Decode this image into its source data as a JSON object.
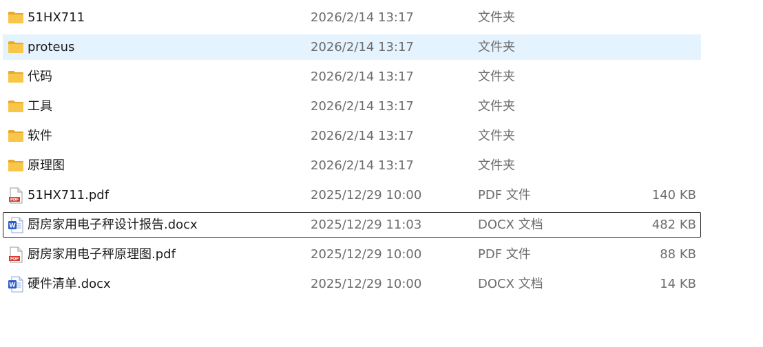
{
  "files": [
    {
      "kind": "folder",
      "name": "51HX711",
      "date": "2026/2/14 13:17",
      "type": "文件夹",
      "size": ""
    },
    {
      "kind": "folder",
      "name": "proteus",
      "date": "2026/2/14 13:17",
      "type": "文件夹",
      "size": ""
    },
    {
      "kind": "folder",
      "name": "代码",
      "date": "2026/2/14 13:17",
      "type": "文件夹",
      "size": ""
    },
    {
      "kind": "folder",
      "name": "工具",
      "date": "2026/2/14 13:17",
      "type": "文件夹",
      "size": ""
    },
    {
      "kind": "folder",
      "name": "软件",
      "date": "2026/2/14 13:17",
      "type": "文件夹",
      "size": ""
    },
    {
      "kind": "folder",
      "name": "原理图",
      "date": "2026/2/14 13:17",
      "type": "文件夹",
      "size": ""
    },
    {
      "kind": "pdf",
      "name": "51HX711.pdf",
      "date": "2025/12/29 10:00",
      "type": "PDF 文件",
      "size": "140 KB"
    },
    {
      "kind": "docx",
      "name": "厨房家用电子秤设计报告.docx",
      "date": "2025/12/29 11:03",
      "type": "DOCX 文档",
      "size": "482 KB"
    },
    {
      "kind": "pdf",
      "name": "厨房家用电子秤原理图.pdf",
      "date": "2025/12/29 10:00",
      "type": "PDF 文件",
      "size": "88 KB"
    },
    {
      "kind": "docx",
      "name": "硬件清单.docx",
      "date": "2025/12/29 10:00",
      "type": "DOCX 文档",
      "size": "14 KB"
    }
  ],
  "icons": {
    "folder": "folder-icon",
    "pdf": "pdf-file-icon",
    "docx": "word-doc-icon"
  },
  "pdf_badge": "PDF",
  "word_badge": "W",
  "colors": {
    "hover_row": "#e5f3ff",
    "focus_border": "#1f1f1f",
    "folder": "#f8c74a",
    "pdf_red": "#d63b2f",
    "word_blue": "#2b5ec9"
  },
  "state": {
    "hover_row_index": 1,
    "focused_row_index": 7
  }
}
